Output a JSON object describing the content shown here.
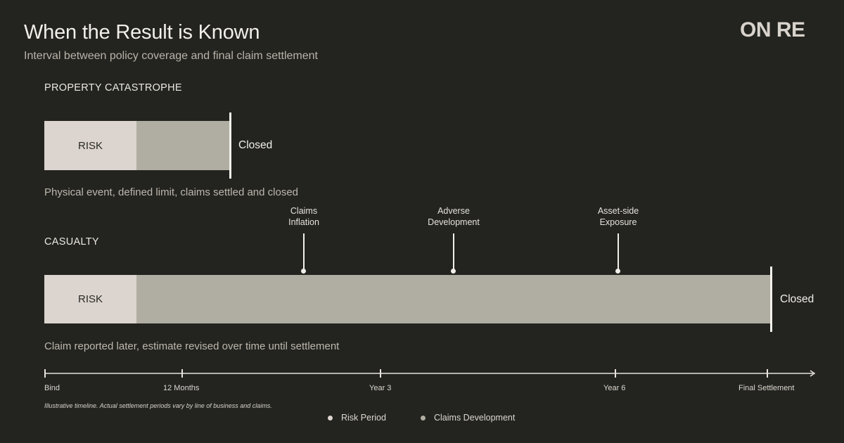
{
  "title": "When the Result is Known",
  "subtitle": "Interval between policy coverage and final claim settlement",
  "logo": "ON RE",
  "colors": {
    "background": "#23241f",
    "risk": "#dcd4cf",
    "development": "#b0ada2",
    "accent": "#f4f1ec"
  },
  "chart_data": {
    "type": "bar",
    "title": "When the Result is Known",
    "subtitle": "Interval between policy coverage and final claim settlement",
    "x_ticks": [
      "Bind",
      "12 Months",
      "Year 3",
      "Year 6",
      "Final Settlement"
    ],
    "rows": [
      {
        "label": "PROPERTY CATASTROPHE",
        "risk_label": "RISK",
        "end_label": "Closed",
        "description": "Physical event, defined limit, claims settled and closed",
        "markers": []
      },
      {
        "label": "CASUALTY",
        "risk_label": "RISK",
        "end_label": "Closed",
        "description": "Claim reported later, estimate revised over time until settlement",
        "markers": [
          {
            "line1": "Claims",
            "line2": "Inflation"
          },
          {
            "line1": "Adverse",
            "line2": "Development"
          },
          {
            "line1": "Asset-side",
            "line2": "Exposure"
          }
        ]
      }
    ],
    "legend": [
      {
        "label": "Risk Period",
        "color": "#dcd4cf"
      },
      {
        "label": "Claims Development",
        "color": "#b0ada2"
      }
    ],
    "legend_position": "bottom-center",
    "footnote": "Illustrative timeline. Actual settlement periods vary by line of business and claims."
  }
}
